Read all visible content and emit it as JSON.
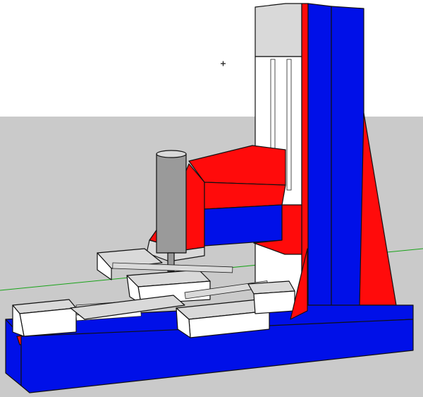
{
  "colors": {
    "sky": "#ffffff",
    "ground": "#cacaca",
    "red": "#ff0b0b",
    "blue": "#0010e8",
    "white": "#ffffff",
    "light_gray": "#d9d9d9",
    "mid_gray": "#9a9a9a",
    "green_axis": "#1aa31a",
    "edge": "#111111"
  },
  "scene": {
    "view_type": "3d-model-viewport",
    "model_subject": "cnc-milling-machine",
    "axis_line": "green",
    "icons": [
      "cursor-crosshair-icon"
    ]
  }
}
